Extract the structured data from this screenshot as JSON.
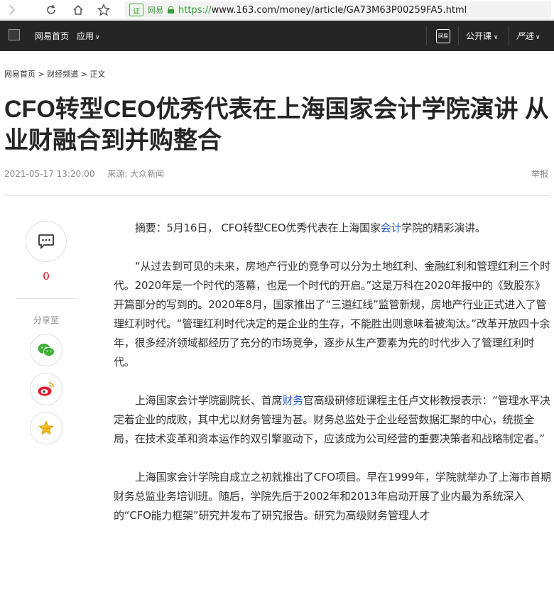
{
  "browser": {
    "secure_badge": "证",
    "secure_name": "网易",
    "url_proto": "https://",
    "url_rest": "www.163.com/money/article/GA73M63P00259FA5.html"
  },
  "header": {
    "home": "网易首页",
    "apps": "应用",
    "mobile_icon_text": "网易",
    "open_course": "公开课",
    "yanxuan": "严选"
  },
  "breadcrumb": {
    "home": "网易首页",
    "channel": "财经频道",
    "current": "正文"
  },
  "article": {
    "title": "CFO转型CEO优秀代表在上海国家会计学院演讲 从业财融合到并购整合",
    "date": "2021-05-17 13:20:00",
    "source": "来源: 大众新闻",
    "report": "举报",
    "p1_a": "摘要：5月16日， CFO转型CEO优秀代表在上海国家",
    "p1_link": "会计",
    "p1_b": "学院的精彩演讲。",
    "p2": "“从过去到可见的未来，房地产行业的竞争可以分为土地红利、金融红利和管理红利三个时代。2020年是一个时代的落幕，也是一个时代的开启。”这是万科在2020年报中的《致股东》开篇部分的写到的。2020年8月，国家推出了“三道红线”监管新规，房地产行业正式进入了管理红利时代。“管理红利时代决定的是企业的生存，不能胜出则意味着被淘汰。”改革开放四十余年，很多经济领域都经历了充分的市场竞争，逐步从生产要素为先的时代步入了管理红利时代。",
    "p3_a": "上海国家会计学院副院长、首席",
    "p3_link": "财务",
    "p3_b": "官高级研修班课程主任卢文彬教授表示：“管理水平决定着企业的成败，其中尤以财务管理为甚。财务总监处于企业经营数据汇聚的中心，统揽全局，在技术变革和资本运作的双引擎驱动下，应该成为公司经营的重要决策者和战略制定者。”",
    "p4": "上海国家会计学院自成立之初就推出了CFO项目。早在1999年，学院就举办了上海市首期财务总监业务培训班。随后，学院先后于2002年和2013年启动开展了业内最为系统深入的“CFO能力框架”研究并发布了研究报告。研究为高级财务管理人才"
  },
  "share": {
    "comment_count": "0",
    "label": "分享至"
  },
  "colors": {
    "header_bg": "#252525",
    "link": "#1e5ac8",
    "secure": "#3a9a3a",
    "wechat": "#3cb034",
    "weibo": "#e6162d",
    "star": "#f5a623"
  }
}
